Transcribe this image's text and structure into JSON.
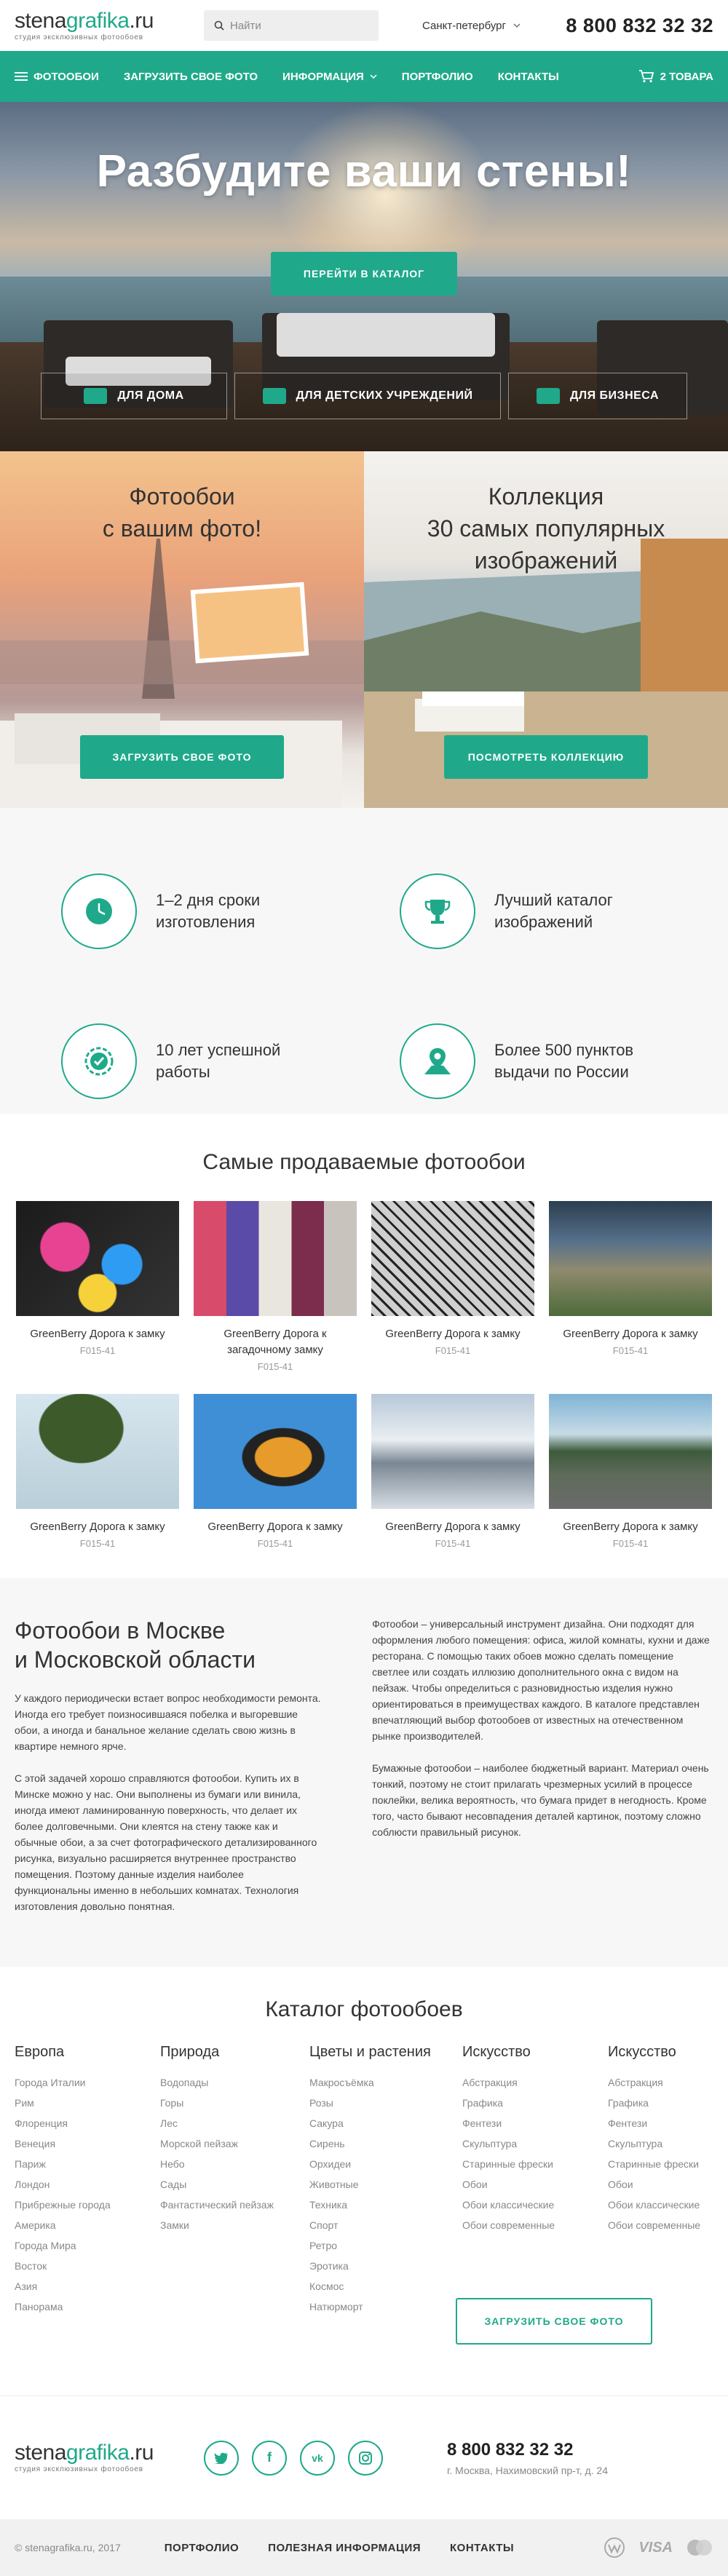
{
  "header": {
    "logo": {
      "part1": "stena",
      "part2": "grafika",
      "part3": ".ru",
      "tagline": "студия эксклюзивных фотообоев"
    },
    "search_placeholder": "Найти",
    "city": "Санкт-петербург",
    "phone": "8 800 832 32 32"
  },
  "nav": {
    "items": [
      "ФОТООБОИ",
      "ЗАГРУЗИТЬ СВОЕ ФОТО",
      "ИНФОРМАЦИЯ",
      "ПОРТФОЛИО",
      "КОНТАКТЫ"
    ],
    "cart": "2 ТОВАРА"
  },
  "hero": {
    "title": "Разбудите ваши стены!",
    "button": "ПЕРЕЙТИ В КАТАЛОГ",
    "categories": [
      "ДЛЯ ДОМА",
      "ДЛЯ ДЕТСКИХ УЧРЕЖДЕНИЙ",
      "ДЛЯ БИЗНЕСА"
    ]
  },
  "promo": {
    "left": {
      "title_line1": "Фотообои",
      "title_line2": "с вашим фото!",
      "button": "ЗАГРУЗИТЬ СВОЕ ФОТО"
    },
    "right": {
      "title_line1": "Коллекция",
      "title_line2": "30 самых популярных",
      "title_line3": "изображений",
      "button": "ПОСМОТРЕТЬ КОЛЛЕКЦИЮ"
    }
  },
  "features": [
    {
      "icon": "clock-icon",
      "text": "1–2 дня сроки изготовления"
    },
    {
      "icon": "trophy-icon",
      "text": "Лучший каталог изображений"
    },
    {
      "icon": "badge-check-icon",
      "text": "10 лет успешной работы"
    },
    {
      "icon": "map-pin-icon",
      "text": "Более 500 пунктов выдачи по России"
    }
  ],
  "bestsellers": {
    "title": "Самые продаваемые фотообои",
    "items": [
      {
        "name": "GreenBerry Дорога к замку",
        "code": "F015-41"
      },
      {
        "name": "GreenBerry Дорога к загадочному замку",
        "code": "F015-41"
      },
      {
        "name": "GreenBerry Дорога к замку",
        "code": "F015-41"
      },
      {
        "name": "GreenBerry Дорога к замку",
        "code": "F015-41"
      },
      {
        "name": "GreenBerry Дорога к замку",
        "code": "F015-41"
      },
      {
        "name": "GreenBerry Дорога к замку",
        "code": "F015-41"
      },
      {
        "name": "GreenBerry Дорога к замку",
        "code": "F015-41"
      },
      {
        "name": "GreenBerry Дорога к замку",
        "code": "F015-41"
      }
    ]
  },
  "about": {
    "title_line1": "Фотообои в Москве",
    "title_line2": "и Московской области",
    "left_p1": "У каждого периодически встает вопрос необходимости ремонта. Иногда его требует поизносившаяся побелка и выгоревшие обои, а иногда и банальное желание сделать свою жизнь в квартире немного ярче.",
    "left_p2": "С этой задачей хорошо справляются фотообои. Купить их в Минске можно у нас. Они выполнены из бумаги или винила, иногда имеют ламинированную поверхность, что делает их более долговечными. Они клеятся на стену также как и обычные обои, а за счет фотографического детализированного рисунка, визуально расширяется внутреннее пространство помещения. Поэтому данные изделия наиболее функциональны именно в небольших комнатах. Технология изготовления довольно понятная.",
    "right_p1": "Фотообои – универсальный инструмент дизайна. Они подходят для оформления любого помещения: офиса, жилой комнаты, кухни и даже ресторана. С помощью таких обоев можно сделать помещение светлее или создать иллюзию дополнительного окна с видом на пейзаж. Чтобы определиться с разновидностью изделия нужно ориентироваться в преимуществах каждого. В каталоге представлен впечатляющий выбор фотообоев от известных на отечественном рынке производителей.",
    "right_p2": "Бумажные фотообои – наиболее бюджетный вариант. Материал очень тонкий, поэтому не стоит прилагать чрезмерных усилий в процессе поклейки, велика вероятность, что бумага придет в негодность. Кроме того, часто бывают несовпадения деталей картинок, поэтому сложно соблюсти правильный рисунок."
  },
  "catalog": {
    "title": "Каталог фотообоев",
    "columns": [
      {
        "heading": "Европа",
        "links": [
          "Города Италии",
          "Рим",
          "Флоренция",
          "Венеция",
          "Париж",
          "Лондон",
          "Прибрежные города",
          "Америка",
          "Города Мира",
          "Восток",
          "Азия",
          "Панорама"
        ]
      },
      {
        "heading": "Природа",
        "links": [
          "Водопады",
          "Горы",
          "Лес",
          "Морской пейзаж",
          "Небо",
          "Сады",
          "Фантастический пейзаж",
          "Замки"
        ]
      },
      {
        "heading": "Цветы и растения",
        "links": [
          "Макросъёмка",
          "Розы",
          "Сакура",
          "Сирень",
          "Орхидеи",
          "Животные",
          "Техника",
          "Спорт",
          "Ретро",
          "Эротика",
          "Космос",
          "Натюрморт"
        ]
      },
      {
        "heading": "Искусство",
        "links": [
          "Абстракция",
          "Графика",
          "Фентези",
          "Скульптура",
          "Старинные фрески",
          "Обои",
          "Обои классические",
          "Обои современные"
        ]
      },
      {
        "heading": "Искусство",
        "links": [
          "Абстракция",
          "Графика",
          "Фентези",
          "Скульптура",
          "Старинные фрески",
          "Обои",
          "Обои классические",
          "Обои современные"
        ]
      }
    ],
    "button": "ЗАГРУЗИТЬ СВОЕ ФОТО"
  },
  "footer": {
    "social": [
      "twitter-icon",
      "facebook-icon",
      "vk-icon",
      "instagram-icon"
    ],
    "phone": "8 800 832 32 32",
    "address": "г. Москва, Нахимовский пр-т, д. 24",
    "copyright": "© stenagrafika.ru, 2017",
    "links": [
      "ПОРТФОЛИО",
      "ПОЛЕЗНАЯ ИНФОРМАЦИЯ",
      "КОНТАКТЫ"
    ],
    "payments": [
      "webmoney-icon",
      "VISA",
      "mastercard-icon"
    ]
  }
}
